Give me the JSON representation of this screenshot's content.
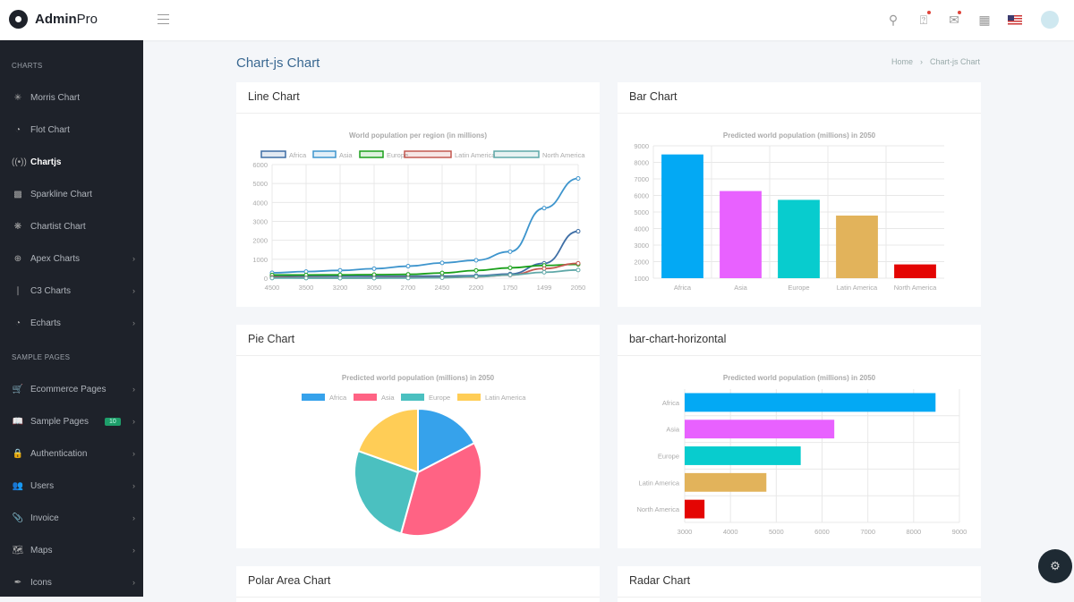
{
  "app": {
    "brand_bold": "Admin",
    "brand_light": "Pro"
  },
  "topbar": {
    "icons": [
      "search-icon",
      "bell-icon",
      "inbox-icon",
      "grid-icon",
      "us-flag-icon",
      "avatar"
    ],
    "notification_dots": {
      "bell": true,
      "inbox": true
    }
  },
  "sidebar": {
    "sections": [
      {
        "header": "CHARTS",
        "items": [
          {
            "label": "Morris Chart",
            "icon": "sparkle-icon",
            "chevron": false
          },
          {
            "label": "Flot Chart",
            "icon": "pie-icon",
            "chevron": false
          },
          {
            "label": "Chartjs",
            "icon": "broadcast-icon",
            "chevron": false,
            "active": true
          },
          {
            "label": "Sparkline Chart",
            "icon": "card-icon",
            "chevron": false
          },
          {
            "label": "Chartist Chart",
            "icon": "cog-chart-icon",
            "chevron": false
          },
          {
            "label": "Apex Charts",
            "icon": "globe-icon",
            "chevron": true
          },
          {
            "label": "C3 Charts",
            "icon": "bar-icon",
            "chevron": true
          },
          {
            "label": "Echarts",
            "icon": "pie-icon",
            "chevron": true
          }
        ]
      },
      {
        "header": "SAMPLE PAGES",
        "items": [
          {
            "label": "Ecommerce Pages",
            "icon": "cart-icon",
            "chevron": true
          },
          {
            "label": "Sample Pages",
            "icon": "book-icon",
            "chevron": true,
            "badge": "10"
          },
          {
            "label": "Authentication",
            "icon": "lock-icon",
            "chevron": true
          },
          {
            "label": "Users",
            "icon": "users-icon",
            "chevron": true
          },
          {
            "label": "Invoice",
            "icon": "paperclip-icon",
            "chevron": true
          },
          {
            "label": "Maps",
            "icon": "map-icon",
            "chevron": true
          },
          {
            "label": "Icons",
            "icon": "feather-icon",
            "chevron": true
          }
        ]
      }
    ]
  },
  "page": {
    "title": "Chart-js Chart",
    "breadcrumb": [
      "Home",
      "Chart-js Chart"
    ]
  },
  "cards": {
    "line": "Line Chart",
    "bar": "Bar Chart",
    "pie": "Pie Chart",
    "hbar": "bar-chart-horizontal",
    "polar": "Polar Area Chart",
    "radar": "Radar Chart"
  },
  "colors": {
    "accent": "#3a6891",
    "sidebar_bg": "#1e222a",
    "badge": "#1e9e6a"
  },
  "chart_data": [
    {
      "type": "line",
      "title": "World population per region (in millions)",
      "x": [
        "4500",
        "3500",
        "3200",
        "3050",
        "2700",
        "2450",
        "2200",
        "1750",
        "1499",
        "2050"
      ],
      "ylim": [
        0,
        6000
      ],
      "yticks": [
        0,
        1000,
        2000,
        3000,
        4000,
        5000,
        6000
      ],
      "legend": "top",
      "series": [
        {
          "name": "Africa",
          "color": "#3e6ea5",
          "values": [
            86,
            114,
            106,
            106,
            107,
            111,
            133,
            221,
            783,
            2478
          ]
        },
        {
          "name": "Asia",
          "color": "#3e95cd",
          "values": [
            282,
            350,
            411,
            502,
            635,
            809,
            947,
            1402,
            3700,
            5267
          ]
        },
        {
          "name": "Europe",
          "color": "#1ba01b",
          "values": [
            168,
            170,
            178,
            190,
            203,
            276,
            408,
            547,
            675,
            734
          ]
        },
        {
          "name": "Latin America",
          "color": "#c45850",
          "values": [
            40,
            20,
            10,
            16,
            24,
            38,
            74,
            167,
            508,
            784
          ]
        },
        {
          "name": "North America",
          "color": "#5fa8a8",
          "values": [
            6,
            3,
            2,
            2,
            7,
            26,
            82,
            172,
            312,
            433
          ]
        }
      ]
    },
    {
      "type": "bar",
      "title": "Predicted world population (millions) in 2050",
      "categories": [
        "Africa",
        "Asia",
        "Europe",
        "Latin America",
        "North America"
      ],
      "values": [
        8478,
        6267,
        5734,
        4784,
        1833
      ],
      "colors": [
        "#03a9f4",
        "#e861ff",
        "#08ccce",
        "#e2b35b",
        "#e40503"
      ],
      "ylim": [
        1000,
        9000
      ],
      "yticks": [
        1000,
        2000,
        3000,
        4000,
        5000,
        6000,
        7000,
        8000,
        9000
      ]
    },
    {
      "type": "pie",
      "title": "Predicted world population (millions) in 2050",
      "categories": [
        "Africa",
        "Asia",
        "Europe",
        "Latin America"
      ],
      "values": [
        2478,
        5267,
        3734,
        2784
      ],
      "colors": [
        "#36a2eb",
        "#ff6384",
        "#4bc0c0",
        "#ffcd56"
      ],
      "legend": "top"
    },
    {
      "type": "bar",
      "orientation": "horizontal",
      "title": "Predicted world population (millions) in 2050",
      "categories": [
        "Africa",
        "Asia",
        "Europe",
        "Latin America",
        "North America"
      ],
      "values": [
        8478,
        6267,
        5534,
        4784,
        3433
      ],
      "colors": [
        "#03a9f4",
        "#e861ff",
        "#08ccce",
        "#e2b35b",
        "#e40503"
      ],
      "xlim": [
        3000,
        9000
      ],
      "xticks": [
        3000,
        4000,
        5000,
        6000,
        7000,
        8000,
        9000
      ]
    }
  ]
}
